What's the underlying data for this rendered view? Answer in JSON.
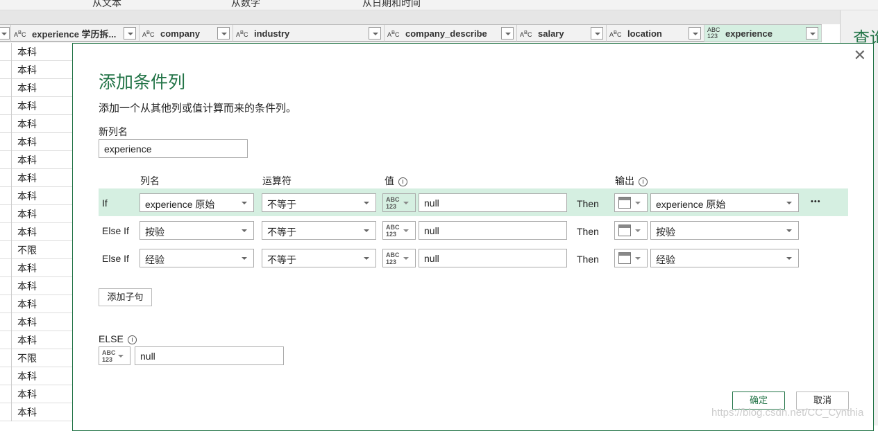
{
  "ribbon": {
    "items": [
      "从文本",
      "从数字",
      "从日期和时间"
    ]
  },
  "columns": [
    {
      "name": "experience 学历拆...",
      "type": "ABC"
    },
    {
      "name": "company",
      "type": "ABC"
    },
    {
      "name": "industry",
      "type": "ABC"
    },
    {
      "name": "company_describe",
      "type": "ABC"
    },
    {
      "name": "salary",
      "type": "ABC"
    },
    {
      "name": "location",
      "type": "ABC"
    },
    {
      "name": "experience",
      "type": "ABC123"
    }
  ],
  "rows": [
    "本科",
    "本科",
    "本科",
    "本科",
    "本科",
    "本科",
    "本科",
    "本科",
    "本科",
    "本科",
    "本科",
    "不限",
    "本科",
    "本科",
    "本科",
    "本科",
    "本科",
    "不限",
    "本科",
    "本科",
    "本科"
  ],
  "right_panel": {
    "title": "查询"
  },
  "dialog": {
    "title": "添加条件列",
    "subtitle": "添加一个从其他列或值计算而来的条件列。",
    "new_col_label": "新列名",
    "new_col_value": "experience",
    "headers": {
      "column": "列名",
      "operator": "运算符",
      "value": "值",
      "output": "输出"
    },
    "clauses": [
      {
        "kind": "If",
        "column": "experience 原始",
        "operator": "不等于",
        "value": "null",
        "then": "Then",
        "output": "experience 原始"
      },
      {
        "kind": "Else If",
        "column": "按验",
        "operator": "不等于",
        "value": "null",
        "then": "Then",
        "output": "按验"
      },
      {
        "kind": "Else If",
        "column": "经验",
        "operator": "不等于",
        "value": "null",
        "then": "Then",
        "output": "经验"
      }
    ],
    "add_clause": "添加子句",
    "else_label": "ELSE",
    "else_value": "null",
    "ok": "确定",
    "cancel": "取消",
    "more": "•••"
  },
  "watermark": "https://blog.csdn.net/CC_Cynthia",
  "colors": {
    "accent": "#217346",
    "selected": "#d5efe1"
  }
}
